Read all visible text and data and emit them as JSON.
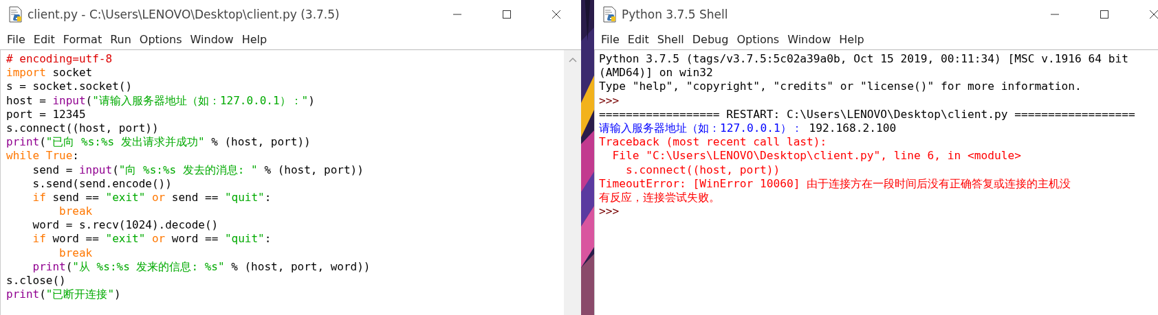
{
  "editor_window": {
    "title": "client.py - C:\\Users\\LENOVO\\Desktop\\client.py (3.7.5)",
    "menu": [
      "File",
      "Edit",
      "Format",
      "Run",
      "Options",
      "Window",
      "Help"
    ],
    "lines": [
      [
        {
          "kind": "comment",
          "text": "# encoding=utf-8"
        }
      ],
      [
        {
          "kind": "keyword",
          "text": "import"
        },
        {
          "kind": "plain",
          "text": " socket"
        }
      ],
      [
        {
          "kind": "plain",
          "text": "s = socket.socket()"
        }
      ],
      [
        {
          "kind": "plain",
          "text": "host = "
        },
        {
          "kind": "builtin",
          "text": "input"
        },
        {
          "kind": "plain",
          "text": "("
        },
        {
          "kind": "string",
          "text": "\"请输入服务器地址（如：127.0.0.1）：\""
        },
        {
          "kind": "plain",
          "text": ")"
        }
      ],
      [
        {
          "kind": "plain",
          "text": "port = 12345"
        }
      ],
      [
        {
          "kind": "plain",
          "text": "s.connect((host, port))"
        }
      ],
      [
        {
          "kind": "builtin",
          "text": "print"
        },
        {
          "kind": "plain",
          "text": "("
        },
        {
          "kind": "string",
          "text": "\"已向 %s:%s 发出请求并成功\""
        },
        {
          "kind": "plain",
          "text": " % (host, port))"
        }
      ],
      [
        {
          "kind": "keyword",
          "text": "while True"
        },
        {
          "kind": "plain",
          "text": ":"
        }
      ],
      [
        {
          "kind": "plain",
          "text": "    send = "
        },
        {
          "kind": "builtin",
          "text": "input"
        },
        {
          "kind": "plain",
          "text": "("
        },
        {
          "kind": "string",
          "text": "\"向 %s:%s 发去的消息: \""
        },
        {
          "kind": "plain",
          "text": " % (host, port))"
        }
      ],
      [
        {
          "kind": "plain",
          "text": "    s.send(send.encode())"
        }
      ],
      [
        {
          "kind": "keyword",
          "text": "    if"
        },
        {
          "kind": "plain",
          "text": " send == "
        },
        {
          "kind": "string",
          "text": "\"exit\""
        },
        {
          "kind": "keyword",
          "text": " or"
        },
        {
          "kind": "plain",
          "text": " send == "
        },
        {
          "kind": "string",
          "text": "\"quit\""
        },
        {
          "kind": "plain",
          "text": ":"
        }
      ],
      [
        {
          "kind": "keyword",
          "text": "        break"
        }
      ],
      [
        {
          "kind": "plain",
          "text": "    word = s.recv(1024).decode()"
        }
      ],
      [
        {
          "kind": "keyword",
          "text": "    if"
        },
        {
          "kind": "plain",
          "text": " word == "
        },
        {
          "kind": "string",
          "text": "\"exit\""
        },
        {
          "kind": "keyword",
          "text": " or"
        },
        {
          "kind": "plain",
          "text": " word == "
        },
        {
          "kind": "string",
          "text": "\"quit\""
        },
        {
          "kind": "plain",
          "text": ":"
        }
      ],
      [
        {
          "kind": "keyword",
          "text": "        break"
        }
      ],
      [
        {
          "kind": "builtin",
          "text": "    print"
        },
        {
          "kind": "plain",
          "text": "("
        },
        {
          "kind": "string",
          "text": "\"从 %s:%s 发来的信息: %s\""
        },
        {
          "kind": "plain",
          "text": " % (host, port, word))"
        }
      ],
      [
        {
          "kind": "plain",
          "text": "s.close()"
        }
      ],
      [
        {
          "kind": "builtin",
          "text": "print"
        },
        {
          "kind": "plain",
          "text": "("
        },
        {
          "kind": "string",
          "text": "\"已断开连接\""
        },
        {
          "kind": "plain",
          "text": ")"
        }
      ]
    ]
  },
  "shell_window": {
    "title": "Python 3.7.5 Shell",
    "menu": [
      "File",
      "Edit",
      "Shell",
      "Debug",
      "Options",
      "Window",
      "Help"
    ],
    "lines": [
      [
        {
          "kind": "plain",
          "text": "Python 3.7.5 (tags/v3.7.5:5c02a39a0b, Oct 15 2019, 00:11:34) [MSC v.1916 64 bit"
        }
      ],
      [
        {
          "kind": "plain",
          "text": "(AMD64)] on win32"
        }
      ],
      [
        {
          "kind": "plain",
          "text": "Type \"help\", \"copyright\", \"credits\" or \"license()\" for more information."
        }
      ],
      [
        {
          "kind": "prompt",
          "text": ">>>"
        }
      ],
      [
        {
          "kind": "plain",
          "text": "================== RESTART: C:\\Users\\LENOVO\\Desktop\\client.py =================="
        }
      ],
      [
        {
          "kind": "stdout",
          "text": "请输入服务器地址（如：127.0.0.1）："
        },
        {
          "kind": "plain",
          "text": " 192.168.2.100"
        }
      ],
      [
        {
          "kind": "stderr",
          "text": "Traceback (most recent call last):"
        }
      ],
      [
        {
          "kind": "stderr",
          "text": "  File \"C:\\Users\\LENOVO\\Desktop\\client.py\", line 6, in <module>"
        }
      ],
      [
        {
          "kind": "stderr",
          "text": "    s.connect((host, port))"
        }
      ],
      [
        {
          "kind": "stderr",
          "text": "TimeoutError: [WinError 10060] 由于连接方在一段时间后没有正确答复或连接的主机没"
        }
      ],
      [
        {
          "kind": "stderr",
          "text": "有反应，连接尝试失败。"
        }
      ],
      [
        {
          "kind": "prompt",
          "text": ">>>"
        }
      ]
    ]
  }
}
